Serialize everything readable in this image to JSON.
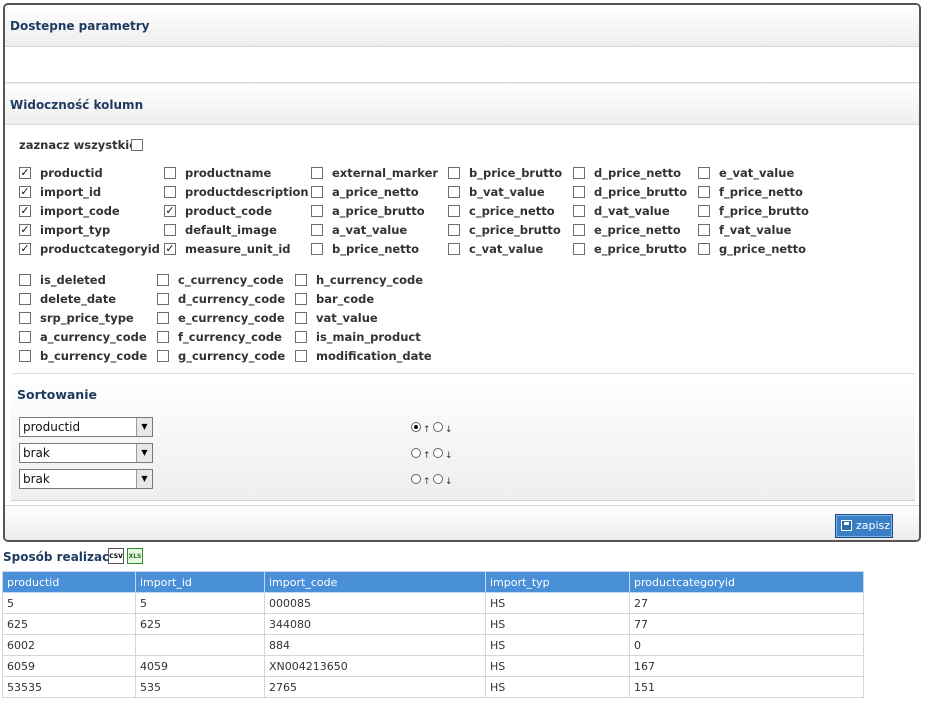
{
  "panel": {
    "section1_title": "Dostepne parametry",
    "section2_title": "Widoczność kolumn",
    "select_all_label": "zaznacz wszystkie",
    "select_all_checked": false
  },
  "columns": [
    {
      "label": "productid",
      "checked": true
    },
    {
      "label": "import_id",
      "checked": true
    },
    {
      "label": "import_code",
      "checked": true
    },
    {
      "label": "import_typ",
      "checked": true
    },
    {
      "label": "productcategoryid",
      "checked": true
    },
    {
      "label": "productname",
      "checked": false
    },
    {
      "label": "productdescription",
      "checked": false
    },
    {
      "label": "product_code",
      "checked": true
    },
    {
      "label": "default_image",
      "checked": false
    },
    {
      "label": "measure_unit_id",
      "checked": true
    },
    {
      "label": "external_marker",
      "checked": false
    },
    {
      "label": "a_price_netto",
      "checked": false
    },
    {
      "label": "a_price_brutto",
      "checked": false
    },
    {
      "label": "a_vat_value",
      "checked": false
    },
    {
      "label": "b_price_netto",
      "checked": false
    },
    {
      "label": "b_price_brutto",
      "checked": false
    },
    {
      "label": "b_vat_value",
      "checked": false
    },
    {
      "label": "c_price_netto",
      "checked": false
    },
    {
      "label": "c_price_brutto",
      "checked": false
    },
    {
      "label": "c_vat_value",
      "checked": false
    },
    {
      "label": "d_price_netto",
      "checked": false
    },
    {
      "label": "d_price_brutto",
      "checked": false
    },
    {
      "label": "d_vat_value",
      "checked": false
    },
    {
      "label": "e_price_netto",
      "checked": false
    },
    {
      "label": "e_price_brutto",
      "checked": false
    },
    {
      "label": "e_vat_value",
      "checked": false
    },
    {
      "label": "f_price_netto",
      "checked": false
    },
    {
      "label": "f_price_brutto",
      "checked": false
    },
    {
      "label": "f_vat_value",
      "checked": false
    },
    {
      "label": "g_price_netto",
      "checked": false
    },
    {
      "label": "is_deleted",
      "checked": false
    },
    {
      "label": "delete_date",
      "checked": false
    },
    {
      "label": "srp_price_type",
      "checked": false
    },
    {
      "label": "a_currency_code",
      "checked": false
    },
    {
      "label": "b_currency_code",
      "checked": false
    },
    {
      "label": "c_currency_code",
      "checked": false
    },
    {
      "label": "d_currency_code",
      "checked": false
    },
    {
      "label": "e_currency_code",
      "checked": false
    },
    {
      "label": "f_currency_code",
      "checked": false
    },
    {
      "label": "g_currency_code",
      "checked": false
    },
    {
      "label": "h_currency_code",
      "checked": false
    },
    {
      "label": "bar_code",
      "checked": false
    },
    {
      "label": "vat_value",
      "checked": false
    },
    {
      "label": "is_main_product",
      "checked": false
    },
    {
      "label": "modification_date",
      "checked": false
    }
  ],
  "sort": {
    "title": "Sortowanie",
    "rows": [
      {
        "value": "productid",
        "asc": true,
        "desc": false
      },
      {
        "value": "brak",
        "asc": false,
        "desc": false
      },
      {
        "value": "brak",
        "asc": false,
        "desc": false
      }
    ],
    "asc_glyph": "↑",
    "desc_glyph": "↓"
  },
  "footer": {
    "save_label": "zapisz"
  },
  "result": {
    "title": "Sposób realizacji",
    "csv_label": "CSV",
    "xls_label": "XLS",
    "headers": [
      "productid",
      "import_id",
      "import_code",
      "import_typ",
      "productcategoryid"
    ],
    "rows": [
      [
        "5",
        "5",
        "000085",
        "HS",
        "27"
      ],
      [
        "625",
        "625",
        "344080",
        "HS",
        "77"
      ],
      [
        "6002",
        "",
        "884",
        "HS",
        "0"
      ],
      [
        "6059",
        "4059",
        "XN004213650",
        "HS",
        "167"
      ],
      [
        "53535",
        "535",
        "2765",
        "HS",
        "151"
      ]
    ]
  }
}
